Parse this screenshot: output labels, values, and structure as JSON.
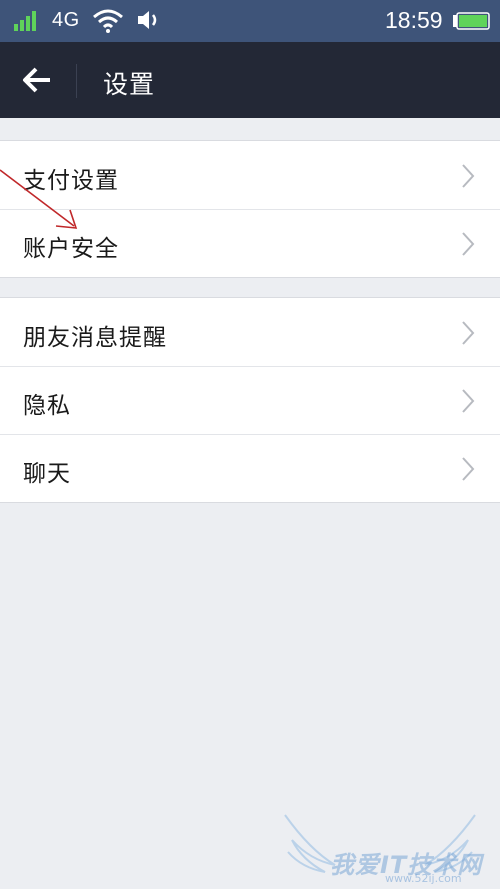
{
  "status_bar": {
    "carrier": "4G",
    "time": "18:59",
    "icons": [
      "signal-icon",
      "wifi-icon",
      "volume-icon",
      "battery-icon"
    ]
  },
  "header": {
    "back_icon": "arrow-left-icon",
    "title": "设置"
  },
  "groups": [
    {
      "items": [
        {
          "label": "支付设置"
        },
        {
          "label": "账户安全"
        }
      ]
    },
    {
      "items": [
        {
          "label": "朋友消息提醒"
        },
        {
          "label": "隐私"
        },
        {
          "label": "聊天"
        }
      ]
    }
  ],
  "watermark": {
    "text": "我爱IT技术网",
    "url": "www.52ij.com"
  },
  "colors": {
    "status_bar_bg": "#3e5479",
    "nav_bar_bg": "#232836",
    "page_bg": "#eceef2",
    "annotation_arrow": "#c0282a"
  }
}
